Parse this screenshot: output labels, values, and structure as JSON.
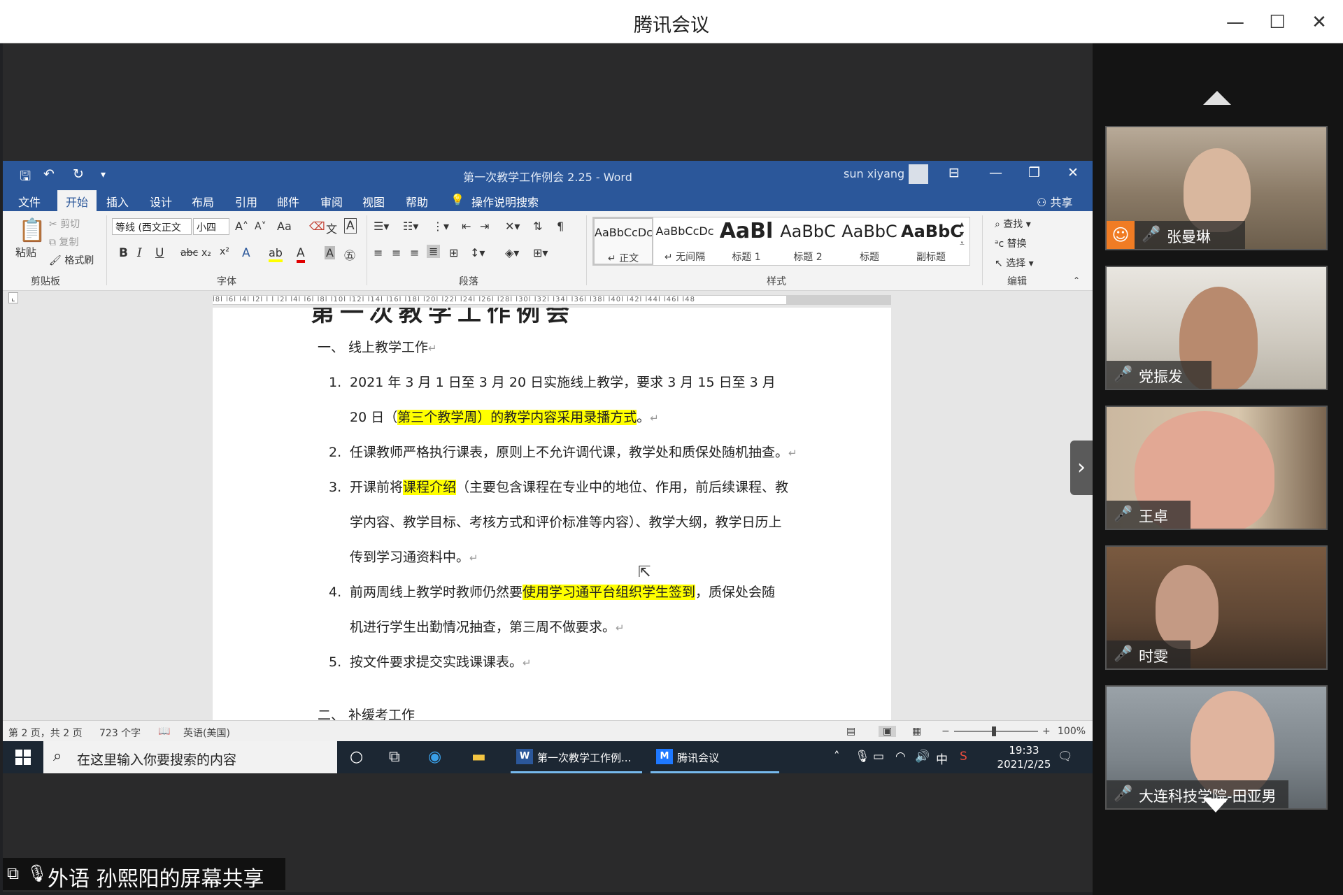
{
  "meeting": {
    "title": "腾讯会议",
    "minimize_icon": "minimize-icon",
    "maximize_icon": "maximize-icon",
    "close_icon": "close-icon",
    "presenter_banner": "外语 孙熙阳的屏幕共享"
  },
  "word": {
    "doc_title": "第一次教学工作例会 2.25  -  Word",
    "user": "sun xiyang",
    "tabs": [
      "文件",
      "开始",
      "插入",
      "设计",
      "布局",
      "引用",
      "邮件",
      "审阅",
      "视图",
      "帮助",
      "操作说明搜索"
    ],
    "share_label": "共享",
    "clipboard": {
      "paste": "粘贴",
      "cut": "剪切",
      "copy": "复制",
      "format_painter": "格式刷",
      "group": "剪贴板"
    },
    "font": {
      "name": "等线 (西文正文",
      "size": "小四",
      "group": "字体",
      "case": "Aa"
    },
    "paragraph_group": "段落",
    "styles": {
      "group": "样式",
      "items": [
        {
          "preview": "AaBbCcDc",
          "name": "↵ 正文"
        },
        {
          "preview": "AaBbCcDc",
          "name": "↵ 无间隔"
        },
        {
          "preview": "AaBl",
          "name": "标题 1"
        },
        {
          "preview": "AaBbC",
          "name": "标题 2"
        },
        {
          "preview": "AaBbC",
          "name": "标题"
        },
        {
          "preview": "AaBbC",
          "name": "副标题"
        }
      ]
    },
    "editing": {
      "find": "查找",
      "replace": "替换",
      "select": "选择",
      "group": "编辑"
    },
    "ruler_text": "l8l l6l l4l l2l l l l2l l4l l6l l8l l10l l12l l14l l16l l18l l20l l22l l24l l26l l28l l30l l32l l34l l36l l38l l40l l42l l44l l46l l48",
    "document": {
      "heading_top": "第一次教学工作例会",
      "section1": "一、      线上教学工作",
      "items": [
        {
          "num": "1.",
          "line1_a": "2021 年 3 月 1 日至  3  月  20  日实施线上教学，要求  3  月  15  日至  3  月",
          "line2_a": "20  日（",
          "line2_hl": "第三个教学周）的教学内容采用录播方式",
          "line2_b": "。"
        },
        {
          "num": "2.",
          "line1_a": "任课教师严格执行课表，原则上不允许调代课，教学处和质保处随机抽查。"
        },
        {
          "num": "3.",
          "line1_a": "开课前将",
          "line1_hl": "课程介绍",
          "line1_b": "（主要包含课程在专业中的地位、作用，前后续课程、教",
          "line2_a": "学内容、教学目标、考核方式和评价标准等内容）、教学大纲，教学日历上",
          "line3_a": "传到学习通资料中。"
        },
        {
          "num": "4.",
          "line1_a": "前两周线上教学时教师仍然要",
          "line1_hl": "使用学习通平台组织学生签到",
          "line1_b": "，质保处会随",
          "line2_a": "机进行学生出勤情况抽查，第三周不做要求。"
        },
        {
          "num": "5.",
          "line1_a": "按文件要求提交实践课课表。"
        }
      ],
      "section2_partial": "二、    补缓考工作"
    },
    "status": {
      "page": "第 2 页，共 2 页",
      "words": "723 个字",
      "language": "英语(美国)",
      "zoom": "100%"
    }
  },
  "taskbar": {
    "search_placeholder": "在这里输入你要搜索的内容",
    "apps": [
      {
        "badge": "W",
        "label": "第一次教学工作例..."
      },
      {
        "badge": "M",
        "label": "腾讯会议"
      }
    ],
    "ime": "中",
    "time": "19:33",
    "date": "2021/2/25"
  },
  "participants": [
    {
      "name": "张曼琳",
      "host": true
    },
    {
      "name": "党振发",
      "host": false
    },
    {
      "name": "王卓",
      "host": false
    },
    {
      "name": "时雯",
      "host": false
    },
    {
      "name": "大连科技学院-田亚男",
      "host": false
    }
  ]
}
